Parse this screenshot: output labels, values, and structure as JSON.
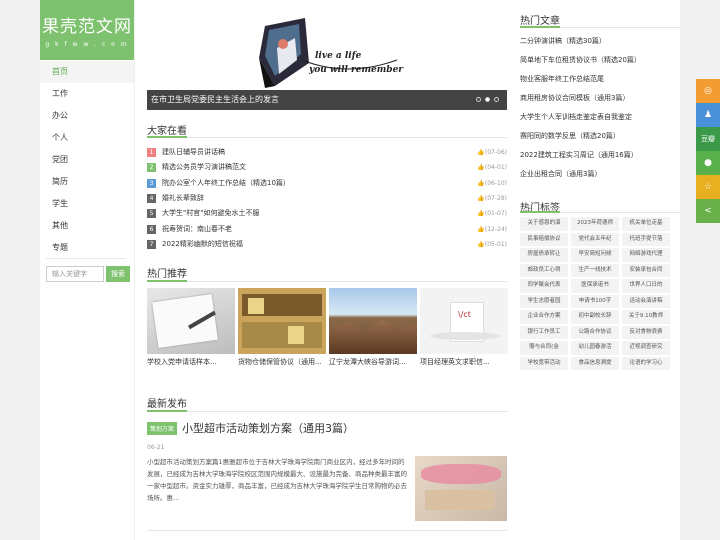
{
  "logo": {
    "title": "果壳范文网",
    "subtitle": "g k f w w . c o m"
  },
  "nav": [
    "首页",
    "工作",
    "办公",
    "个人",
    "党团",
    "简历",
    "学生",
    "其他",
    "专题"
  ],
  "search": {
    "placeholder": "输入关键字",
    "button": "搜索"
  },
  "slider": {
    "caption": "在市卫生局党委民主生活会上的发言",
    "text1": "live a life",
    "text2": "you will remember"
  },
  "look": {
    "title": "大家在看",
    "items": [
      {
        "n": "1",
        "text": "建队日辅导员讲话稿",
        "date": "(07-06)",
        "color": "#f08080"
      },
      {
        "n": "2",
        "text": "精选公务员学习演讲稿范文",
        "date": "(04-01)",
        "color": "#7ec16e"
      },
      {
        "n": "3",
        "text": "院办公室个人年终工作总结（精选10篇）",
        "date": "(06-10)",
        "color": "#5b9bd5"
      },
      {
        "n": "4",
        "text": "婚礼长辈致辞",
        "date": "(07-28)",
        "color": "#666666"
      },
      {
        "n": "5",
        "text": "大学生\"村官\"如何避免水土不服",
        "date": "(01-07)",
        "color": "#666666"
      },
      {
        "n": "6",
        "text": "祝寿贺词：南山春不老",
        "date": "(12-24)",
        "color": "#666666"
      },
      {
        "n": "7",
        "text": "2022精彩幽默的短信祝福",
        "date": "(05-01)",
        "color": "#666666"
      }
    ]
  },
  "recommend": {
    "title": "热门推荐",
    "items": [
      "学校入党申请话样本...",
      "货物仓储保管协议（通用...",
      "辽宁龙潭大峡谷导游词...",
      "项目经理英文求职信..."
    ]
  },
  "latest": {
    "title": "最新发布",
    "tag": "策划方案",
    "headline": "小型超市活动策划方案（通用3篇）",
    "date": "06-21",
    "summary": "小型超市活动策划方案篇1惠雅超市位于吉林大学珠海学院南门商业区内，经过多年时间的发展，已经成为吉林大学珠海学院校区范围内规模最大、设施最为完备、商品种类最丰富的一家中型超市。资金实力雄厚，商品丰富，已经成为吉林大学珠海学院学生日常购物的必去场所。惠..."
  },
  "hot_articles": {
    "title": "热门文章",
    "items": [
      "二分钟演讲稿（精选30篇）",
      "简单地下车位租赁协议书（精选20篇）",
      "物业客服年终工作总结范尾",
      "商用租房协议合同模板（通用3篇）",
      "大学生个人军训档走鉴定表自我鉴定",
      "赛阳同的数学反思（精选20篇）",
      "2022建筑工程实习周记（通用16篇）",
      "企业出租合同（通用3篇）"
    ]
  },
  "hot_tags": {
    "title": "热门标签",
    "items": [
      "关于感恩的演",
      "2023年荷德师",
      "机关单位走基",
      "民事赔偿协议",
      "党代会五年纪",
      "托班手提节落",
      "房屋债承转让",
      "早安简短问候",
      "网络游戏代理",
      "邮政员工心得",
      "生产一线技术",
      "安装承包合同",
      "同学聚会代表",
      "医保承诺书",
      "世界人口日的",
      "学生志愿者园",
      "申请书100字",
      "运动会演讲稿",
      "企业合作方案",
      "初中副校长辞",
      "关于9.10教师",
      "银行工作员工",
      "公路合作协议",
      "反对食物浪费",
      "赠与合同(金",
      "幼儿园春游活",
      "近视调查研究",
      "学校宽带活动",
      "食品信息溯提",
      "论语的学习心"
    ]
  },
  "share": [
    "weibo-icon",
    "qq-icon",
    "douban-icon",
    "wechat-icon",
    "favorite-icon",
    "share-icon"
  ],
  "share_labels": [
    "",
    "",
    "豆瓣",
    "",
    "",
    ""
  ],
  "colors": {
    "accent": "#7ec16e"
  }
}
